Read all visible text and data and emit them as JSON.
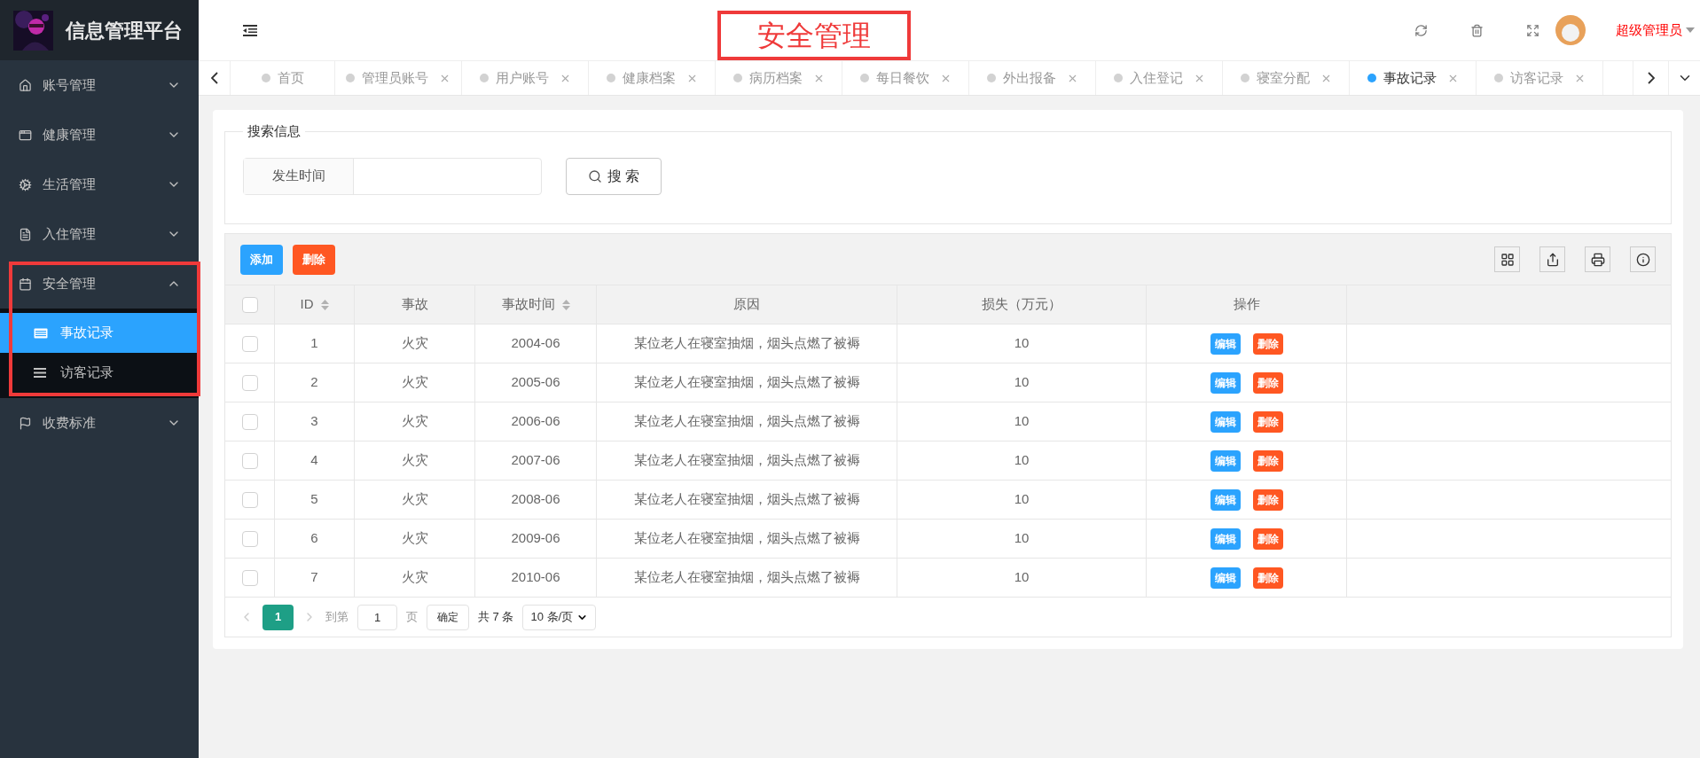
{
  "brand": {
    "title": "信息管理平台"
  },
  "sidebar": {
    "items": [
      {
        "label": "账号管理",
        "expanded": false
      },
      {
        "label": "健康管理",
        "expanded": false
      },
      {
        "label": "生活管理",
        "expanded": false
      },
      {
        "label": "入住管理",
        "expanded": false
      },
      {
        "label": "安全管理",
        "expanded": true,
        "children": [
          {
            "label": "事故记录",
            "selected": true
          },
          {
            "label": "访客记录",
            "selected": false
          }
        ]
      },
      {
        "label": "收费标准",
        "expanded": false
      }
    ]
  },
  "header": {
    "user": "超级管理员"
  },
  "tabs": [
    {
      "label": "首页",
      "selected": false,
      "closable": false
    },
    {
      "label": "管理员账号",
      "selected": false,
      "closable": true
    },
    {
      "label": "用户账号",
      "selected": false,
      "closable": true
    },
    {
      "label": "健康档案",
      "selected": false,
      "closable": true
    },
    {
      "label": "病历档案",
      "selected": false,
      "closable": true
    },
    {
      "label": "每日餐饮",
      "selected": false,
      "closable": true
    },
    {
      "label": "外出报备",
      "selected": false,
      "closable": true
    },
    {
      "label": "入住登记",
      "selected": false,
      "closable": true
    },
    {
      "label": "寝室分配",
      "selected": false,
      "closable": true
    },
    {
      "label": "事故记录",
      "selected": true,
      "closable": true
    },
    {
      "label": "访客记录",
      "selected": false,
      "closable": true
    }
  ],
  "annotation": {
    "title": "安全管理"
  },
  "search": {
    "legend": "搜索信息",
    "field_label": "发生时间",
    "button": "搜 索"
  },
  "toolbar": {
    "buttons": [
      {
        "label": "添加",
        "kind": "primary"
      },
      {
        "label": "删除",
        "kind": "danger"
      }
    ]
  },
  "table": {
    "select_all": false,
    "columns": [
      {
        "label": "ID",
        "sortable": true
      },
      {
        "label": "事故",
        "sortable": false
      },
      {
        "label": "事故时间",
        "sortable": true
      },
      {
        "label": "原因",
        "sortable": false
      },
      {
        "label": "损失（万元）",
        "sortable": false
      },
      {
        "label": "操作",
        "sortable": false
      }
    ],
    "rows": [
      {
        "checked": false,
        "cells": [
          "1",
          "火灾",
          "2004-06",
          "某位老人在寝室抽烟，烟头点燃了被褥",
          "10"
        ],
        "actions": [
          "编辑",
          "删除"
        ]
      },
      {
        "checked": false,
        "cells": [
          "2",
          "火灾",
          "2005-06",
          "某位老人在寝室抽烟，烟头点燃了被褥",
          "10"
        ],
        "actions": [
          "编辑",
          "删除"
        ]
      },
      {
        "checked": false,
        "cells": [
          "3",
          "火灾",
          "2006-06",
          "某位老人在寝室抽烟，烟头点燃了被褥",
          "10"
        ],
        "actions": [
          "编辑",
          "删除"
        ]
      },
      {
        "checked": false,
        "cells": [
          "4",
          "火灾",
          "2007-06",
          "某位老人在寝室抽烟，烟头点燃了被褥",
          "10"
        ],
        "actions": [
          "编辑",
          "删除"
        ]
      },
      {
        "checked": false,
        "cells": [
          "5",
          "火灾",
          "2008-06",
          "某位老人在寝室抽烟，烟头点燃了被褥",
          "10"
        ],
        "actions": [
          "编辑",
          "删除"
        ]
      },
      {
        "checked": false,
        "cells": [
          "6",
          "火灾",
          "2009-06",
          "某位老人在寝室抽烟，烟头点燃了被褥",
          "10"
        ],
        "actions": [
          "编辑",
          "删除"
        ]
      },
      {
        "checked": false,
        "cells": [
          "7",
          "火灾",
          "2010-06",
          "某位老人在寝室抽烟，烟头点燃了被褥",
          "10"
        ],
        "actions": [
          "编辑",
          "删除"
        ]
      }
    ]
  },
  "pagination": {
    "pages": [
      {
        "label": "1",
        "selected": true
      }
    ],
    "goto_label": "到第",
    "goto_value": "1",
    "page_unit": "页",
    "confirm": "确定",
    "total": "共 7 条",
    "page_size": "10 条/页"
  }
}
